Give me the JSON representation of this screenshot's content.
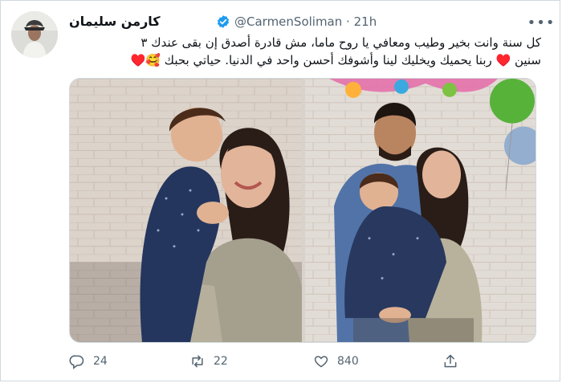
{
  "tweet": {
    "display_name": "كارمن سليمان",
    "handle": "@CarmenSoliman",
    "separator": "·",
    "time": "21h",
    "more_label": "•••",
    "text_line1": "كل سنة وانت بخير وطيب ومعافي يا روح ماما، مش قادرة أصدق إن بقى عندك ٣",
    "text_line2": "سنين ♥️ ربنا يحميك ويخليك لينا وأشوفك أحسن واحد في الدنيا. حياتي بحبك 🥰♥️"
  },
  "stats": {
    "replies": "24",
    "retweets": "22",
    "likes": "840"
  },
  "colors": {
    "verified": "#1d9bf0",
    "icon_gray": "#536471",
    "heart": "#c4132b"
  },
  "icons": {
    "verified": "verified-badge-icon",
    "more": "more-horizontal-icon",
    "reply": "reply-icon",
    "retweet": "retweet-icon",
    "like": "heart-icon",
    "share": "share-icon"
  }
}
